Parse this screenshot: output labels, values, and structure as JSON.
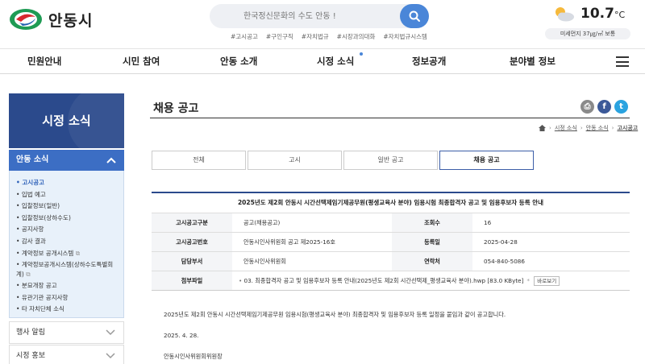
{
  "header": {
    "logo_text": "안동시",
    "search_placeholder": "한국정신문화의 수도 안동 !",
    "quick_links": [
      "#고시공고",
      "#구인구직",
      "#자치법규",
      "#시장과의대화",
      "#자치법규시스템"
    ],
    "weather": {
      "temp": "10.7",
      "unit": "°C",
      "dust": "미세먼지 37㎍/㎥ 보통"
    }
  },
  "gnb": [
    "민원안내",
    "시민 참여",
    "안동 소개",
    "시정 소식",
    "정보공개",
    "분야별 정보"
  ],
  "sidebar": {
    "banner_title": "시정 소식",
    "section_title": "안동 소식",
    "items": [
      "고시공고",
      "입법 예고",
      "입찰정보(일반)",
      "입찰정보(상하수도)",
      "공지사항",
      "감사 결과",
      "계약정보 공개시스템",
      "계약정보공개시스템(상하수도특별회계)",
      "분묘개장 공고",
      "유관기관 공지사항",
      "타 자치단체 소식"
    ],
    "collapsed": [
      "행사 알림",
      "시정 홍보"
    ]
  },
  "content": {
    "page_title": "채용 공고",
    "breadcrumb": [
      "시정 소식",
      "안동 소식",
      "고시공고"
    ],
    "tabs": [
      "전체",
      "고시",
      "일반 공고",
      "채용 공고"
    ],
    "active_tab": "채용 공고",
    "post": {
      "title": "2025년도 제2회 안동시 시간선택제임기제공무원(평생교육사 분야) 임용시험 최종합격자 공고 및 임용후보자 등록 안내",
      "rows": [
        {
          "label1": "고시공고구분",
          "value1": "공고(채용공고)",
          "label2": "조회수",
          "value2": "16"
        },
        {
          "label1": "고시공고번호",
          "value1": "안동시인사위원회 공고 제2025-16호",
          "label2": "등록일",
          "value2": "2025-04-28"
        },
        {
          "label1": "담당부서",
          "value1": "안동시인사위원회",
          "label2": "연락처",
          "value2": "054-840-5086"
        }
      ],
      "attachment": {
        "label": "첨부파일",
        "file": "03. 최종합격자 공고 및 임용후보자 등록 안내(2025년도 제2회 시간선택제_평생교육사 분야).hwp [83.0 KByte]",
        "preview_label": "바로보기"
      },
      "body": [
        "2025년도 제2회 안동시 시간선택제임기제공무원 임용시험(평생교육사 분야) 최종합격자 및 임용후보자 등록 일정을 붙임과 같이 공고합니다.",
        "2025. 4. 28.",
        "안동시인사위원회위원장"
      ]
    }
  },
  "colors": {
    "brand": "#2b4a8c",
    "accent": "#3c6ec4",
    "search_btn": "#4a86d8"
  },
  "icons": [
    "search-icon",
    "weather-icon",
    "menu-icon",
    "print-icon",
    "facebook-icon",
    "twitter-icon",
    "home-icon",
    "chevron-up-icon",
    "chevron-down-icon"
  ]
}
